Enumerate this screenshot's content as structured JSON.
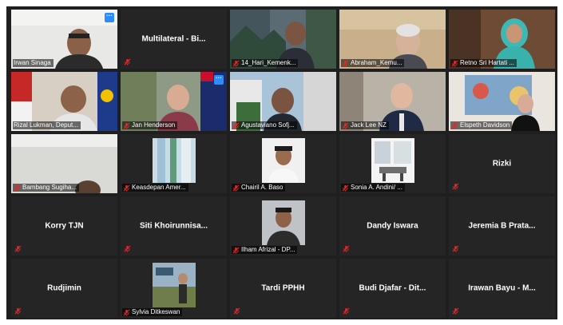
{
  "colors": {
    "tile_bg": "#252525",
    "active_border": "#c9d34a",
    "mic_muted": "#e02828",
    "more_button": "#2d8cff"
  },
  "icons": {
    "muted": "muted-microphone-icon",
    "more": "more-options-icon"
  },
  "tiles": [
    {
      "name": "Irwan Sinaga",
      "kind": "video"
    },
    {
      "name": "Multilateral - Bi...",
      "kind": "name"
    },
    {
      "name": "14_Hari_Kemenk...",
      "kind": "video"
    },
    {
      "name": "Abraham_Kemu...",
      "kind": "video"
    },
    {
      "name": "Retno Sri Hartati ...",
      "kind": "video"
    },
    {
      "name": "Rizal Lukman, Deput...",
      "kind": "video"
    },
    {
      "name": "Jan Henderson",
      "kind": "video"
    },
    {
      "name": "Agustaviano Sofj...",
      "kind": "video"
    },
    {
      "name": "Jack Lee NZ",
      "kind": "video"
    },
    {
      "name": "Elspeth Davidson",
      "kind": "video"
    },
    {
      "name": "Bambang Sugiha...",
      "kind": "video"
    },
    {
      "name": "Keasdepan Amer...",
      "kind": "picture"
    },
    {
      "name": "Chairil A. Baso",
      "kind": "picture"
    },
    {
      "name": "Sonia A. Andini/ ...",
      "kind": "picture"
    },
    {
      "name": "Rizki",
      "kind": "name"
    },
    {
      "name": "Korry TJN",
      "kind": "name"
    },
    {
      "name": "Siti  Khoirunnisa...",
      "kind": "name"
    },
    {
      "name": "Ilham Afrizal - DP...",
      "kind": "picture"
    },
    {
      "name": "Dandy Iswara",
      "kind": "name"
    },
    {
      "name": "Jeremia B Prata...",
      "kind": "name"
    },
    {
      "name": "Rudjimin",
      "kind": "name"
    },
    {
      "name": "Sylvia Ditkeswan",
      "kind": "picture"
    },
    {
      "name": "Tardi PPHH",
      "kind": "name"
    },
    {
      "name": "Budi Djafar - Dit...",
      "kind": "name"
    },
    {
      "name": "Irawan Bayu - M...",
      "kind": "name"
    }
  ]
}
